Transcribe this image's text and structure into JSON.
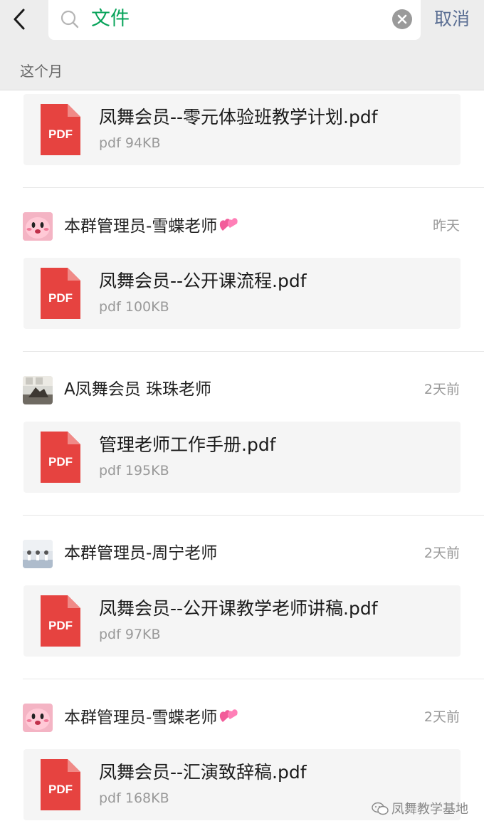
{
  "header": {
    "search_value": "文件",
    "cancel_label": "取消"
  },
  "section_title": "这个月",
  "icons": {
    "back": "chevron-left-icon",
    "search": "search-icon",
    "clear": "clear-icon",
    "file": "pdf-file-icon",
    "heart": "heart-emoji-icon",
    "watermark": "wechat-icon"
  },
  "colors": {
    "accent_green": "#07a35a",
    "cancel_blue": "#5a6e93",
    "pdf_red": "#e64340"
  },
  "pdf_badge": "PDF",
  "groups": [
    {
      "files": [
        {
          "name": "凤舞会员--零元体验班教学计划.pdf",
          "meta": "pdf 94KB"
        }
      ]
    },
    {
      "sender": "本群管理员-雪蝶老师",
      "date": "昨天",
      "files": [
        {
          "name": "凤舞会员--公开课流程.pdf",
          "meta": "pdf 100KB"
        }
      ]
    },
    {
      "sender": "A凤舞会员 珠珠老师",
      "date": "2天前",
      "files": [
        {
          "name": "管理老师工作手册.pdf",
          "meta": "pdf 195KB"
        }
      ]
    },
    {
      "sender": "本群管理员-周宁老师",
      "date": "2天前",
      "files": [
        {
          "name": "凤舞会员--公开课教学老师讲稿.pdf",
          "meta": "pdf 97KB"
        }
      ]
    },
    {
      "sender": "本群管理员-雪蝶老师",
      "date": "2天前",
      "files": [
        {
          "name": "凤舞会员--汇演致辞稿.pdf",
          "meta": "pdf 168KB"
        }
      ]
    }
  ],
  "watermark": "凤舞教学基地"
}
